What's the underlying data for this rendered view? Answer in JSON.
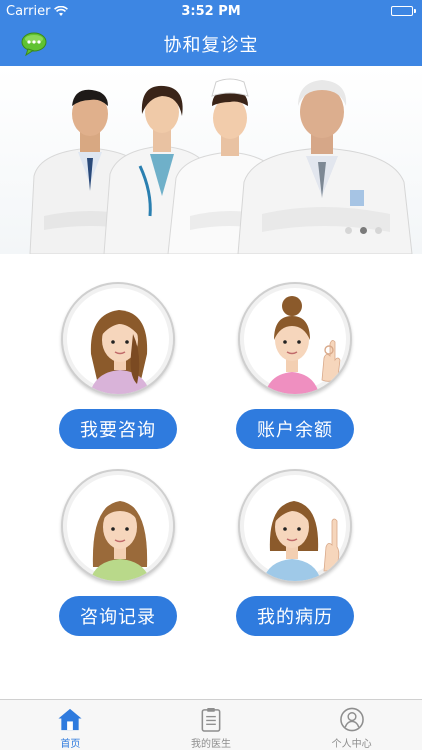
{
  "status_bar": {
    "carrier": "Carrier",
    "time": "3:52 PM"
  },
  "nav": {
    "title": "协和复诊宝",
    "left_icon": "chat-bubble-icon"
  },
  "banner": {
    "page_count": 3,
    "active_page": 2
  },
  "tiles": [
    {
      "label": "我要咨询",
      "avatar": "woman-long-hair-avatar"
    },
    {
      "label": "账户余额",
      "avatar": "woman-ok-gesture-avatar"
    },
    {
      "label": "咨询记录",
      "avatar": "woman-brown-hair-avatar"
    },
    {
      "label": "我的病历",
      "avatar": "woman-pointing-avatar"
    }
  ],
  "tab_bar": {
    "items": [
      {
        "label": "首页",
        "icon": "home-icon",
        "active": true
      },
      {
        "label": "我的医生",
        "icon": "clipboard-icon",
        "active": false
      },
      {
        "label": "个人中心",
        "icon": "user-circle-icon",
        "active": false
      }
    ]
  },
  "colors": {
    "primary": "#3d86e3",
    "button": "#2f7bde",
    "tab_active": "#2f7bde",
    "tab_inactive": "#8e8e8e"
  }
}
